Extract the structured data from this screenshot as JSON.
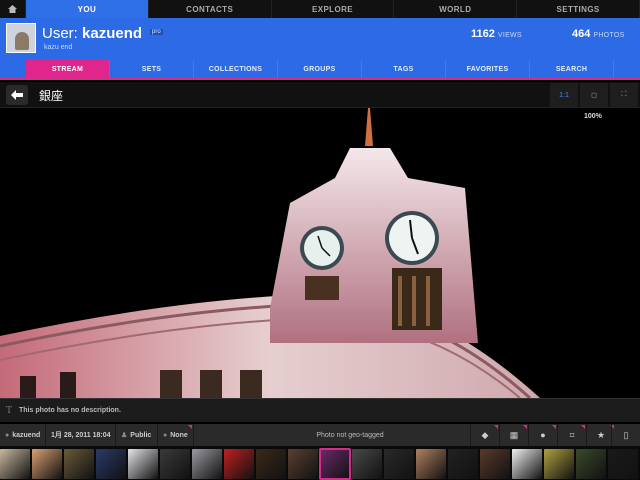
{
  "top_nav": {
    "home_icon": "home-icon",
    "tabs": [
      {
        "label": "YOU",
        "active": true
      },
      {
        "label": "CONTACTS",
        "active": false
      },
      {
        "label": "EXPLORE",
        "active": false
      },
      {
        "label": "WORLD",
        "active": false
      },
      {
        "label": "SETTINGS",
        "active": false
      }
    ]
  },
  "profile": {
    "prefix": "User: ",
    "username": "kazuend",
    "badge": "pro",
    "subname": "kazu end",
    "views_count": "1162",
    "views_label": "VIEWS",
    "photos_count": "464",
    "photos_label": "PHOTOS"
  },
  "sub_tabs": [
    {
      "label": "STREAM",
      "active": true
    },
    {
      "label": "SETS",
      "active": false
    },
    {
      "label": "COLLECTIONS",
      "active": false
    },
    {
      "label": "GROUPS",
      "active": false
    },
    {
      "label": "TAGS",
      "active": false
    },
    {
      "label": "FAVORITES",
      "active": false
    },
    {
      "label": "SEARCH",
      "active": false
    }
  ],
  "photo": {
    "title": "銀座",
    "zoom": "100%",
    "view_modes": [
      "1:1",
      "fit",
      "fullscreen"
    ]
  },
  "description": "This photo has no description.",
  "meta": {
    "owner": "kazuend",
    "date": "1月 28, 2011 18:04",
    "privacy": "Public",
    "license": "None",
    "geo": "Photo not geo-tagged"
  },
  "actions": [
    "tag-icon",
    "sizes-icon",
    "comments-icon",
    "crop-icon",
    "favorite-icon",
    "phone-icon"
  ],
  "colors": {
    "brand_blue": "#2d6be6",
    "accent_pink": "#e0268c"
  },
  "filmstrip": [
    "#c8b8a0",
    "#d8a070",
    "#6a5a3a",
    "#2a3a6a",
    "#e4e4ea",
    "#3a3a3a",
    "#9a9aa2",
    "#c02020",
    "#3a2a1a",
    "#5a4030",
    "#6a2a6a",
    "#4a4a4a",
    "#2a2a2a",
    "#b08060",
    "#222",
    "#5a3a2a",
    "#f0f0f0",
    "#b0a040",
    "#3a4a2a",
    "#1a1a1a",
    "#4a6a9a",
    "#9a8a6a"
  ]
}
